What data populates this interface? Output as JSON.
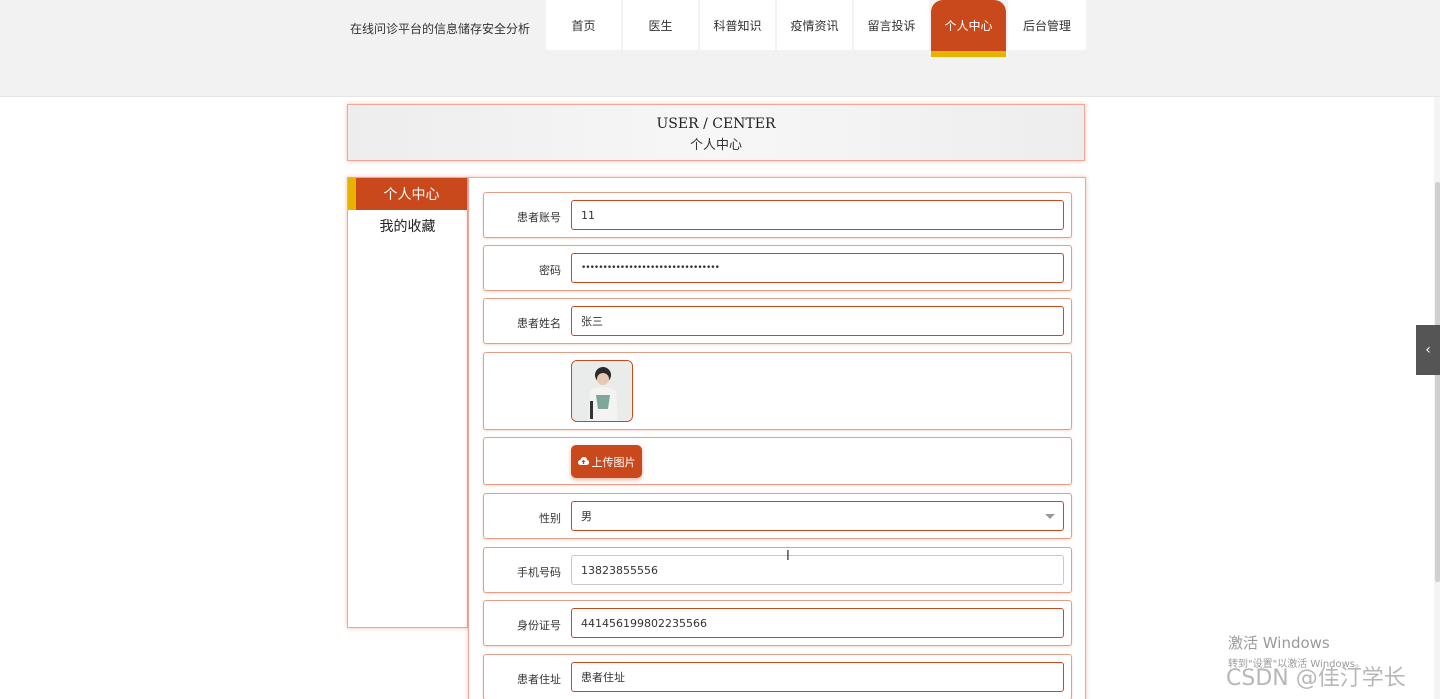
{
  "header": {
    "site_title": "在线问诊平台的信息储存安全分析",
    "nav": [
      "首页",
      "医生",
      "科普知识",
      "疫情资讯",
      "留言投诉",
      "个人中心",
      "后台管理"
    ]
  },
  "banner": {
    "en": "USER / CENTER",
    "cn": "个人中心"
  },
  "sidebar": {
    "active": "个人中心",
    "items": [
      "我的收藏"
    ]
  },
  "form": {
    "account": {
      "label": "患者账号",
      "value": "11"
    },
    "password": {
      "label": "密码",
      "value": "••••••••••••••••••••••••••••••••"
    },
    "name": {
      "label": "患者姓名",
      "value": "张三"
    },
    "upload": {
      "label": "上传图片"
    },
    "gender": {
      "label": "性别",
      "value": "男"
    },
    "phone": {
      "label": "手机号码",
      "value": "13823855556"
    },
    "idcard": {
      "label": "身份证号",
      "value": "441456199802235566"
    },
    "address": {
      "label": "患者住址",
      "value": "患者住址"
    }
  },
  "watermark": {
    "title": "激活 Windows",
    "sub": "转到\"设置\"以激活 Windows。"
  },
  "csdn": "CSDN @佳汀学长",
  "colors": {
    "accent": "#c9491c",
    "highlight": "#e7b300"
  }
}
